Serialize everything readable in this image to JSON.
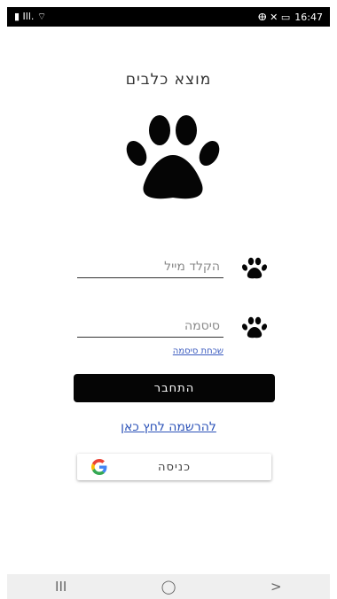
{
  "status_bar": {
    "left_glyphs": "▮ Ill. ⌔",
    "right_glyphs": "ⴲ ✕ ▭",
    "time": "16:47"
  },
  "app": {
    "title": "מוצא כלבים"
  },
  "icons": {
    "logo": "paw-icon",
    "field_icon": "paw-icon",
    "google": "google-icon"
  },
  "login_form": {
    "email_placeholder": "הקלד מייל",
    "email_value": "",
    "password_placeholder": "סיסמה",
    "password_value": "",
    "forgot_password": "שכחת סיסמה",
    "login_button": "התחבר",
    "register_link": "להרשמה לחץ כאן",
    "google_button": "כניסה"
  },
  "nav_bar": {
    "recents": "III",
    "home": "◯",
    "back": ">"
  },
  "colors": {
    "primary": "#050505",
    "link": "#2b52b8",
    "text": "#333333"
  }
}
